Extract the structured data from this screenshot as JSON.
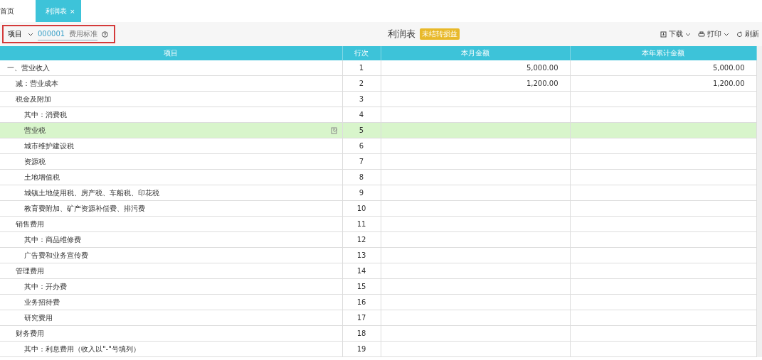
{
  "tabs": [
    {
      "label": "首页",
      "selected": false,
      "closable": false
    },
    {
      "label": "利润表",
      "selected": true,
      "closable": true,
      "close": "×"
    }
  ],
  "filter": {
    "select": "项目",
    "code": "000001",
    "name": "费用标准"
  },
  "report": {
    "title": "利润表",
    "badge": "未结转损益"
  },
  "toolbar": [
    {
      "kind": "download",
      "label": "下载",
      "dropdown": true
    },
    {
      "kind": "print",
      "label": "打印",
      "dropdown": true
    },
    {
      "kind": "refresh",
      "label": "刷新",
      "dropdown": false
    }
  ],
  "table": {
    "columns": [
      "项目",
      "行次",
      "本月金额",
      "本年累计金额"
    ],
    "rows": [
      {
        "item": "一、营业收入",
        "line": "1",
        "month": "5,000.00",
        "year": "5,000.00",
        "selected": false,
        "children": [
          {
            "item": "减：营业成本",
            "line": "2",
            "month": "1,200.00",
            "year": "1,200.00",
            "selected": false
          },
          {
            "item": "税金及附加",
            "line": "3",
            "selected": false,
            "children": [
              {
                "item": "其中：消费税",
                "line": "4",
                "selected": false
              },
              {
                "item": "营业税",
                "line": "5",
                "selected": true
              },
              {
                "item": "城市维护建设税",
                "line": "6",
                "selected": false
              },
              {
                "item": "资源税",
                "line": "7",
                "selected": false
              },
              {
                "item": "土地增值税",
                "line": "8",
                "selected": false
              },
              {
                "item": "城镇土地使用税、房产税、车船税、印花税",
                "line": "9",
                "selected": false
              },
              {
                "item": "教育费附加、矿产资源补偿费、排污费",
                "line": "10",
                "selected": false
              }
            ]
          },
          {
            "item": "销售费用",
            "line": "11",
            "selected": false,
            "children": [
              {
                "item": "其中：商品维修费",
                "line": "12",
                "selected": false
              },
              {
                "item": "广告费和业务宣传费",
                "line": "13",
                "selected": false
              }
            ]
          },
          {
            "item": "管理费用",
            "line": "14",
            "selected": false,
            "children": [
              {
                "item": "其中：开办费",
                "line": "15",
                "selected": false
              },
              {
                "item": "业务招待费",
                "line": "16",
                "selected": false
              },
              {
                "item": "研究费用",
                "line": "17",
                "selected": false
              }
            ]
          },
          {
            "item": "财务费用",
            "line": "18",
            "selected": false,
            "children": [
              {
                "item": "其中：利息费用（收入以\"-\"号填列）",
                "line": "19",
                "selected": false
              }
            ]
          }
        ]
      }
    ]
  }
}
